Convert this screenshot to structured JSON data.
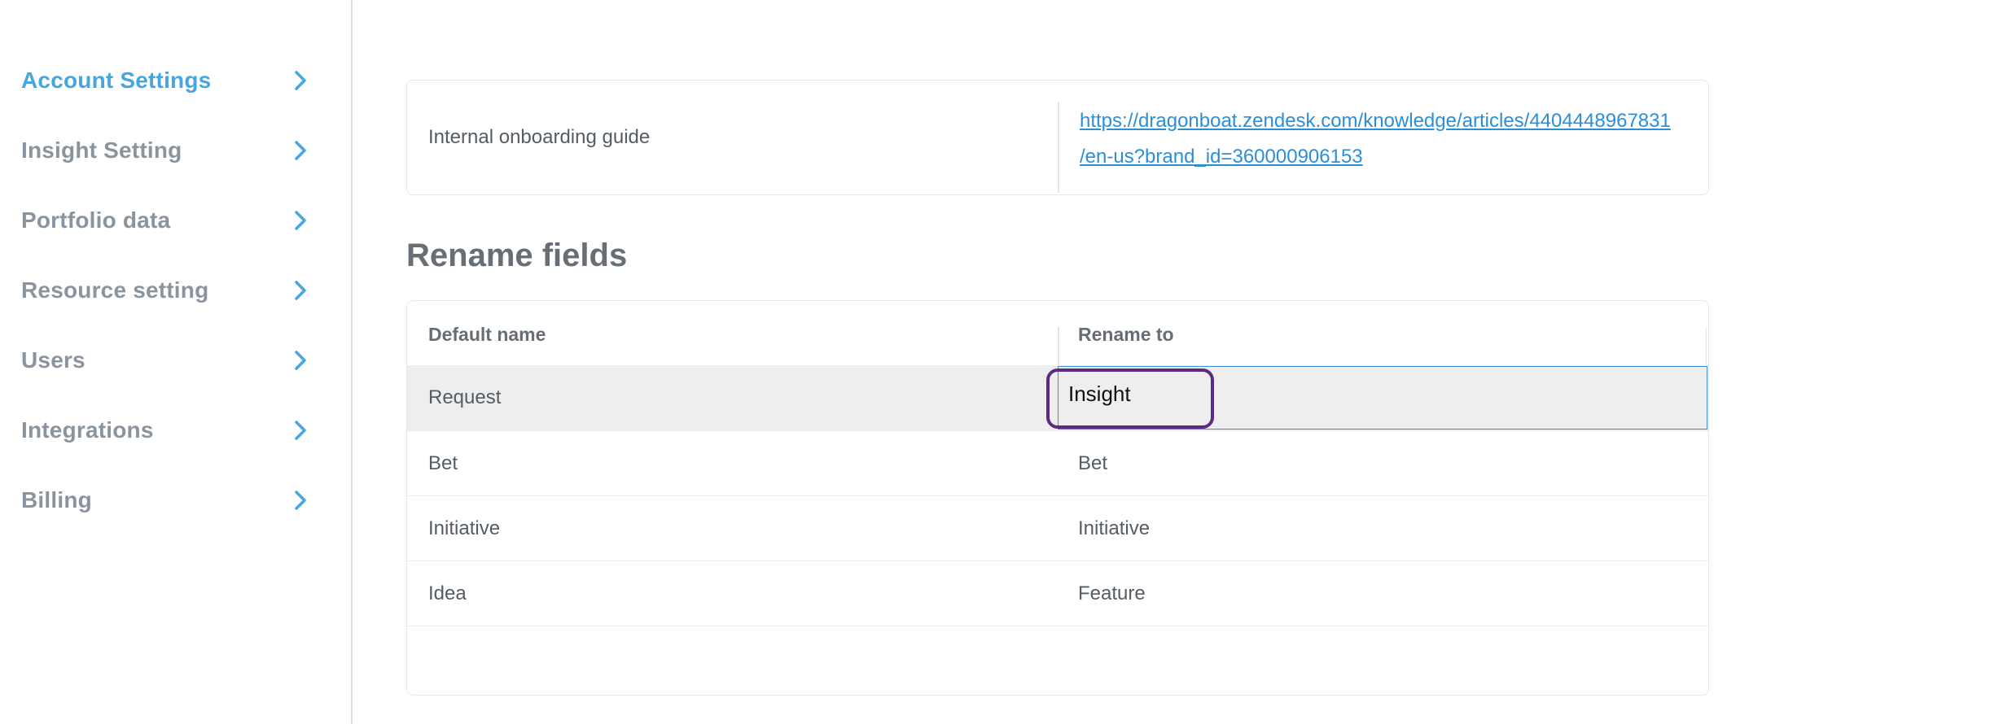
{
  "sidebar": {
    "items": [
      {
        "label": "Account Settings",
        "active": true
      },
      {
        "label": "Insight Setting",
        "active": false
      },
      {
        "label": "Portfolio data",
        "active": false
      },
      {
        "label": "Resource setting",
        "active": false
      },
      {
        "label": "Users",
        "active": false
      },
      {
        "label": "Integrations",
        "active": false
      },
      {
        "label": "Billing",
        "active": false
      }
    ],
    "chevron_icon": "chevron-right-icon",
    "active_color": "#46a6df",
    "inactive_color": "#8a949f"
  },
  "onboarding": {
    "label": "Internal onboarding guide",
    "link_line1": "https://dragonboat.zendesk.com/knowledge/articles/4404448967831",
    "link_line2": "/en-us?brand_id=360000906153"
  },
  "rename_fields": {
    "title": "Rename fields",
    "header_default": "Default name",
    "header_rename": "Rename to",
    "rows": [
      {
        "default": "Request",
        "rename": "Insight"
      },
      {
        "default": "Bet",
        "rename": "Bet"
      },
      {
        "default": "Initiative",
        "rename": "Initiative"
      },
      {
        "default": "Idea",
        "rename": "Feature"
      }
    ]
  }
}
